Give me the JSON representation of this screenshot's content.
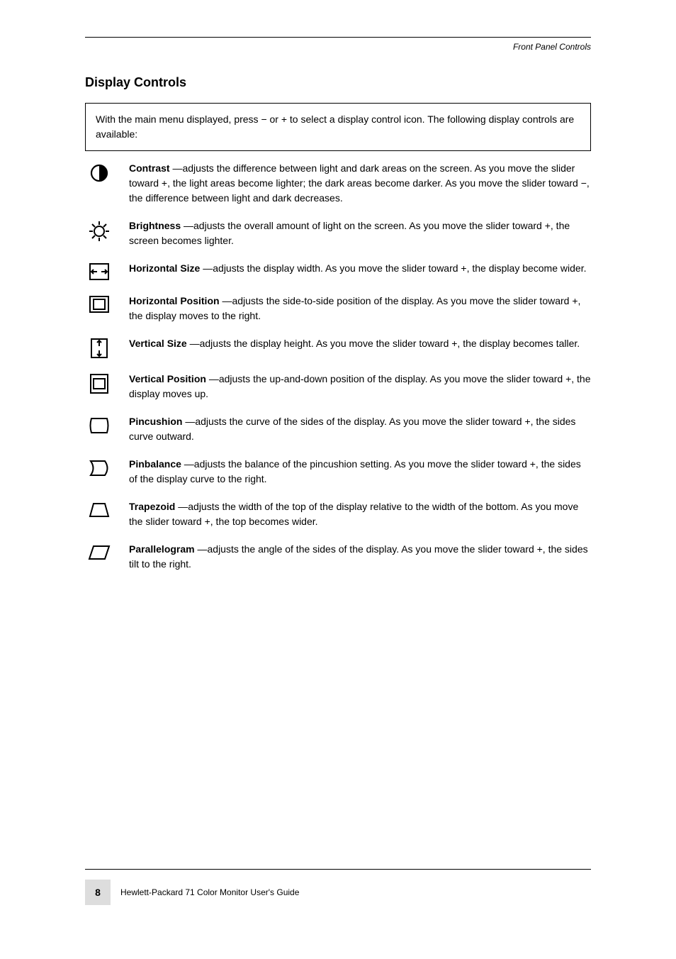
{
  "header": {
    "running_title": "Front Panel Controls"
  },
  "section_title": "Display Controls",
  "control_box_intro": "With the main menu displayed, press − or + to select a display control icon. The following display controls are available:",
  "items": [
    {
      "icon": "contrast-icon",
      "label": "Contrast",
      "desc": " —adjusts the difference between light and dark areas on the screen. As you move the slider toward +, the light areas become lighter; the dark areas become darker. As you move the slider toward −, the difference between light and dark decreases."
    },
    {
      "icon": "brightness-icon",
      "label": "Brightness",
      "desc": " —adjusts the overall amount of light on the screen. As you move the slider toward +, the screen becomes lighter."
    },
    {
      "icon": "horizontal-size-icon",
      "label": "Horizontal Size",
      "desc": " —adjusts the display width. As you move the slider toward +, the display become wider."
    },
    {
      "icon": "horizontal-position-icon",
      "label": "Horizontal Position",
      "desc": " —adjusts the side-to-side position of the display. As you move the slider toward +, the display moves to the right."
    },
    {
      "icon": "vertical-size-icon",
      "label": "Vertical Size",
      "desc": " —adjusts the display height. As you move the slider toward +, the display becomes taller."
    },
    {
      "icon": "vertical-position-icon",
      "label": "Vertical Position",
      "desc": " —adjusts the up-and-down position of the display. As you move the slider toward +, the display moves up."
    },
    {
      "icon": "pincushion-icon",
      "label": "Pincushion",
      "desc": " —adjusts the curve of the sides of the display. As you move the slider toward +, the sides curve outward."
    },
    {
      "icon": "pinbalance-icon",
      "label": "Pinbalance",
      "desc": " —adjusts the balance of the pincushion setting. As you move the slider toward +, the sides of the display curve to the right."
    },
    {
      "icon": "trapezoid-icon",
      "label": "Trapezoid",
      "desc": " —adjusts the width of the top of the display relative to the width of the bottom. As you move the slider toward +, the top becomes wider."
    },
    {
      "icon": "parallelogram-icon",
      "label": "Parallelogram",
      "desc": " —adjusts the angle of the sides of the display. As you move the slider toward +, the sides tilt to the right."
    }
  ],
  "footer": {
    "page_number": "8",
    "doc_title": "Hewlett-Packard 71 Color Monitor User's Guide"
  }
}
